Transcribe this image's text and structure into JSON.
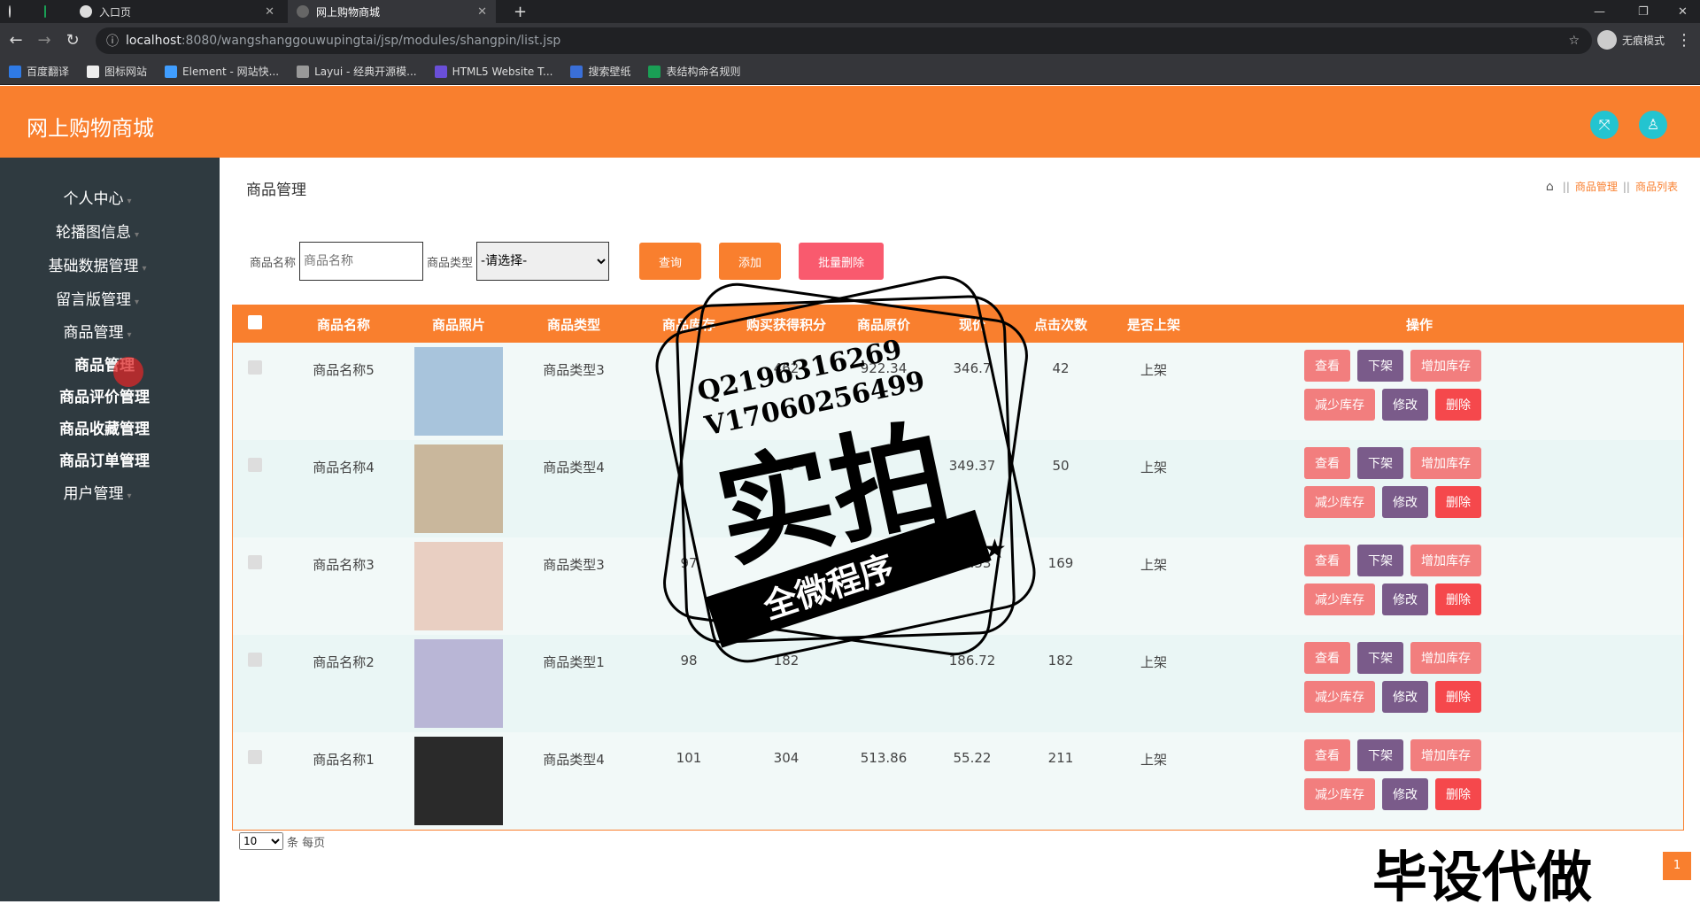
{
  "browser": {
    "tabs": [
      {
        "label": ""
      },
      {
        "label": ""
      },
      {
        "label": "入口页"
      },
      {
        "label": "网上购物商城"
      }
    ],
    "new_tab": "+",
    "url_host": "localhost",
    "url_path": ":8080/wangshanggouwupingtai/jsp/modules/shangpin/list.jsp",
    "incognito_label": "无痕模式",
    "bookmarks": [
      {
        "label": "百度翻译",
        "color": "#2f7ae5"
      },
      {
        "label": "图标网站",
        "color": "#eeeeee"
      },
      {
        "label": "Element - 网站快...",
        "color": "#409eff"
      },
      {
        "label": "Layui - 经典开源模...",
        "color": "#999999"
      },
      {
        "label": "HTML5 Website T...",
        "color": "#6a4fd8"
      },
      {
        "label": "搜索壁纸",
        "color": "#3a6fd8"
      },
      {
        "label": "表结构命名规则",
        "color": "#1a9f55"
      }
    ]
  },
  "app": {
    "title": "网上购物商城",
    "header_icons": [
      "expand-icon",
      "user-icon"
    ],
    "brand_color": "#f97f2e"
  },
  "sidebar": {
    "items": [
      {
        "label": "个人中心",
        "bold": false
      },
      {
        "label": "轮播图信息",
        "bold": false
      },
      {
        "label": "基础数据管理",
        "bold": false
      },
      {
        "label": "留言版管理",
        "bold": false
      },
      {
        "label": "商品管理",
        "bold": false
      },
      {
        "label": "商品管理",
        "bold": true
      },
      {
        "label": "商品评价管理",
        "bold": true
      },
      {
        "label": "商品收藏管理",
        "bold": true
      },
      {
        "label": "商品订单管理",
        "bold": true
      },
      {
        "label": "用户管理",
        "bold": false
      }
    ]
  },
  "main": {
    "page_title": "商品管理",
    "breadcrumb": [
      "商品管理",
      "商品列表"
    ],
    "search": {
      "name_label": "商品名称",
      "name_placeholder": "商品名称",
      "type_label": "商品类型",
      "type_selected": "-请选择-",
      "query_btn": "查询",
      "add_btn": "添加",
      "batch_delete_btn": "批量删除"
    },
    "table": {
      "headers": [
        "商品名称",
        "商品照片",
        "商品类型",
        "商品库存",
        "购买获得积分",
        "商品原价",
        "现价",
        "点击次数",
        "是否上架",
        "操作"
      ],
      "rows": [
        {
          "name": "商品名称5",
          "photo_color": "#a8c4dc",
          "type": "商品类型3",
          "stock": "",
          "points": "462",
          "orig_price": "922.34",
          "price": "346.7",
          "clicks": "42",
          "on_shelf": "上架"
        },
        {
          "name": "商品名称4",
          "photo_color": "#c9b79c",
          "type": "商品类型4",
          "stock": "",
          "points": "78",
          "orig_price": "",
          "price": "349.37",
          "clicks": "50",
          "on_shelf": "上架"
        },
        {
          "name": "商品名称3",
          "photo_color": "#e9cfc2",
          "type": "商品类型3",
          "stock": "97",
          "points": "",
          "orig_price": "",
          "price": "31.53",
          "clicks": "169",
          "on_shelf": "上架"
        },
        {
          "name": "商品名称2",
          "photo_color": "#b9b6d6",
          "type": "商品类型1",
          "stock": "98",
          "points": "182",
          "orig_price": "",
          "price": "186.72",
          "clicks": "182",
          "on_shelf": "上架"
        },
        {
          "name": "商品名称1",
          "photo_color": "#2a2a2a",
          "type": "商品类型4",
          "stock": "101",
          "points": "304",
          "orig_price": "513.86",
          "price": "55.22",
          "clicks": "211",
          "on_shelf": "上架"
        }
      ],
      "ops": {
        "view": "查看",
        "off": "下架",
        "add_stock": "增加库存",
        "sub_stock": "减少库存",
        "edit": "修改",
        "delete": "删除"
      }
    },
    "pager": {
      "page_size": "10",
      "suffix": "条 每页"
    }
  },
  "watermark": {
    "line1": "Q2196316269",
    "line2": "V17060256499",
    "big": "实拍",
    "banner": "全微程序",
    "bottom": "毕设代做"
  },
  "page_badge": "1"
}
